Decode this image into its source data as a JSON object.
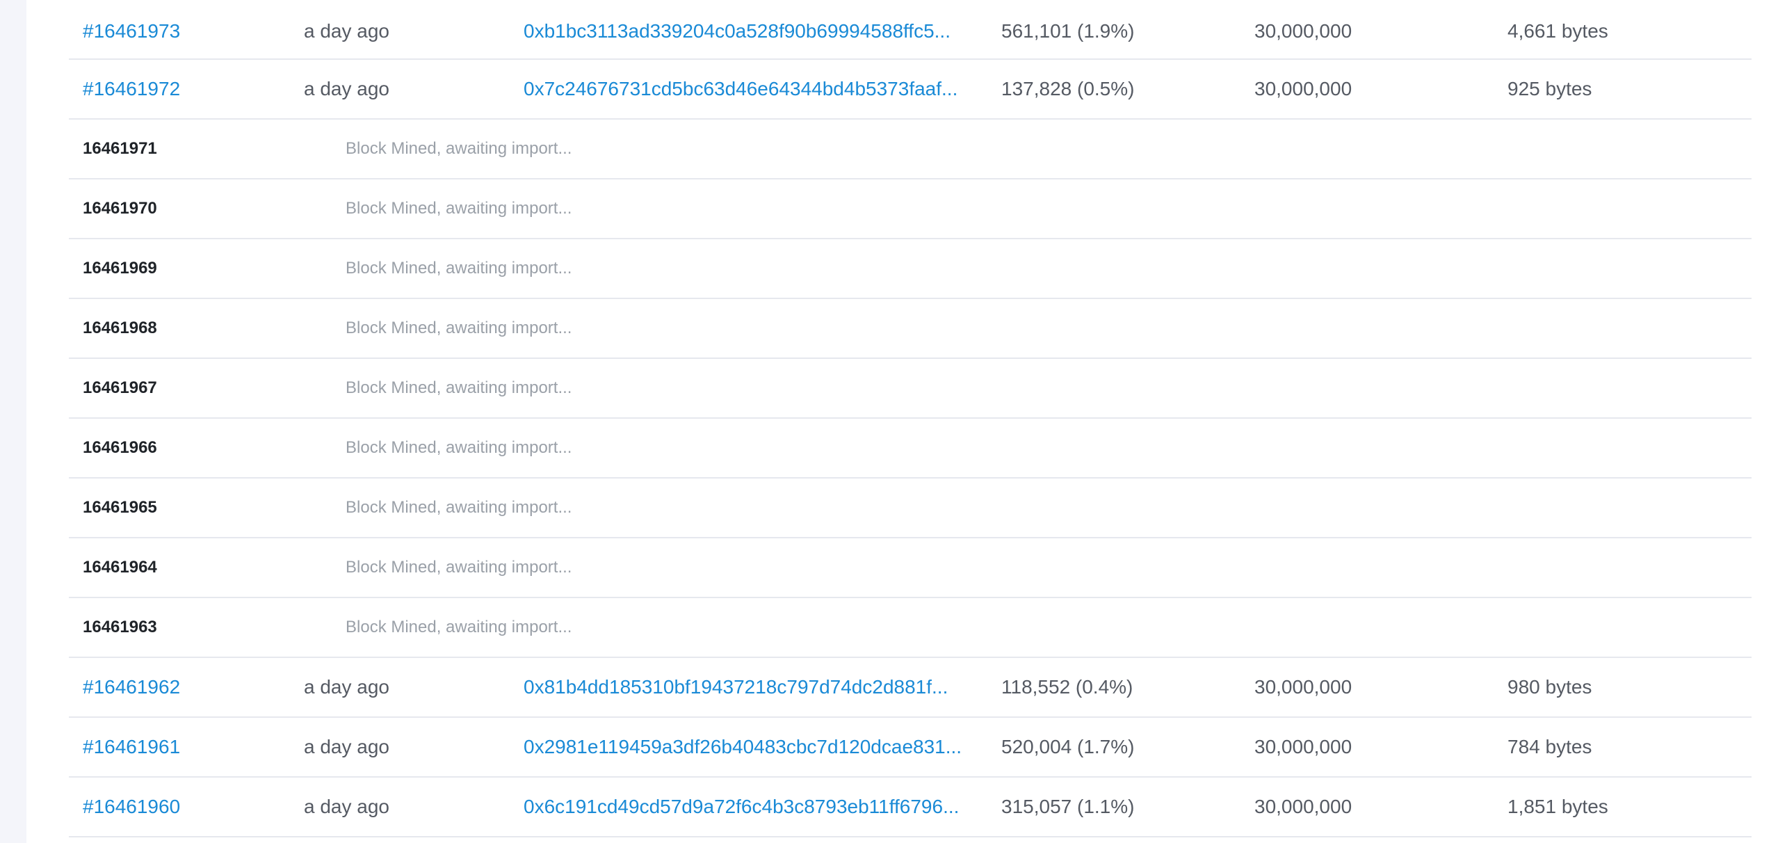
{
  "blocks": [
    {
      "type": "mined",
      "number": "#16461973",
      "age": "a day ago",
      "hash": "0xb1bc3113ad339204c0a528f90b69994588ffc5...",
      "gas_used": "561,101 (1.9%)",
      "gas_limit": "30,000,000",
      "size": "4,661 bytes"
    },
    {
      "type": "mined",
      "number": "#16461972",
      "age": "a day ago",
      "hash": "0x7c24676731cd5bc63d46e64344bd4b5373faaf...",
      "gas_used": "137,828 (0.5%)",
      "gas_limit": "30,000,000",
      "size": "925 bytes"
    },
    {
      "type": "pending",
      "number": "16461971",
      "status": "Block Mined, awaiting import..."
    },
    {
      "type": "pending",
      "number": "16461970",
      "status": "Block Mined, awaiting import..."
    },
    {
      "type": "pending",
      "number": "16461969",
      "status": "Block Mined, awaiting import..."
    },
    {
      "type": "pending",
      "number": "16461968",
      "status": "Block Mined, awaiting import..."
    },
    {
      "type": "pending",
      "number": "16461967",
      "status": "Block Mined, awaiting import..."
    },
    {
      "type": "pending",
      "number": "16461966",
      "status": "Block Mined, awaiting import..."
    },
    {
      "type": "pending",
      "number": "16461965",
      "status": "Block Mined, awaiting import..."
    },
    {
      "type": "pending",
      "number": "16461964",
      "status": "Block Mined, awaiting import..."
    },
    {
      "type": "pending",
      "number": "16461963",
      "status": "Block Mined, awaiting import..."
    },
    {
      "type": "mined",
      "number": "#16461962",
      "age": "a day ago",
      "hash": "0x81b4dd185310bf19437218c797d74dc2d881f...",
      "gas_used": "118,552 (0.4%)",
      "gas_limit": "30,000,000",
      "size": "980 bytes"
    },
    {
      "type": "mined",
      "number": "#16461961",
      "age": "a day ago",
      "hash": "0x2981e119459a3df26b40483cbc7d120dcae831...",
      "gas_used": "520,004 (1.7%)",
      "gas_limit": "30,000,000",
      "size": "784 bytes"
    },
    {
      "type": "mined",
      "number": "#16461960",
      "age": "a day ago",
      "hash": "0x6c191cd49cd57d9a72f6c4b3c8793eb11ff6796...",
      "gas_used": "315,057 (1.1%)",
      "gas_limit": "30,000,000",
      "size": "1,851 bytes"
    }
  ],
  "colors": {
    "link": "#1a8ad6",
    "text_muted": "#555a63",
    "pending_status": "#9aa0a8",
    "row_border": "#e6e8ee",
    "gutter": "#f4f5fa"
  }
}
